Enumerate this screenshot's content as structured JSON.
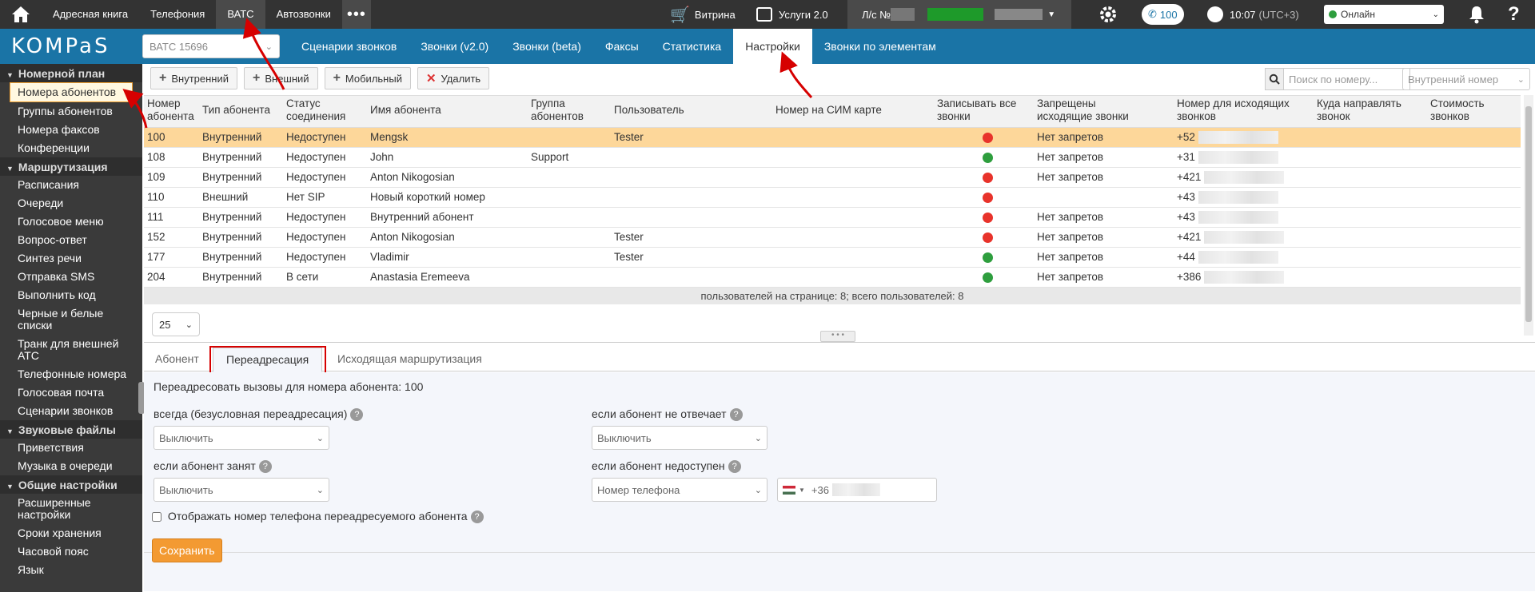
{
  "topbar": {
    "links": [
      "Адресная книга",
      "Телефония",
      "ВАТС",
      "Автозвонки"
    ],
    "active": "ВАТС",
    "vitrina": "Витрина",
    "services": "Услуги 2.0",
    "account_label": "Л/с №",
    "call_count": "100",
    "time": "10:07",
    "timezone": "(UTC+3)",
    "status": "Онлайн"
  },
  "navbar": {
    "logo": "KOMPaS",
    "vats_select": "ВАТС 15696",
    "tabs": [
      "Сценарии звонков",
      "Звонки (v2.0)",
      "Звонки (beta)",
      "Факсы",
      "Статистика",
      "Настройки",
      "Звонки по элементам"
    ],
    "active_tab": "Настройки"
  },
  "sidebar": {
    "sections": [
      {
        "title": "Номерной план",
        "items": [
          "Номера абонентов",
          "Группы абонентов",
          "Номера факсов",
          "Конференции"
        ]
      },
      {
        "title": "Маршрутизация",
        "items": [
          "Расписания",
          "Очереди",
          "Голосовое меню",
          "Вопрос-ответ",
          "Синтез речи",
          "Отправка SMS",
          "Выполнить код",
          "Черные и белые списки",
          "Транк для внешней АТС",
          "Телефонные номера",
          "Голосовая почта",
          "Сценарии звонков"
        ]
      },
      {
        "title": "Звуковые файлы",
        "items": [
          "Приветствия",
          "Музыка в очереди"
        ]
      },
      {
        "title": "Общие настройки",
        "items": [
          "Расширенные настройки",
          "Сроки хранения",
          "Часовой пояс",
          "Язык"
        ]
      }
    ],
    "active_item": "Номера абонентов"
  },
  "toolbar": {
    "internal": "Внутренний",
    "external": "Внешний",
    "mobile": "Мобильный",
    "delete": "Удалить",
    "search_placeholder": "Поиск по номеру...",
    "filter_select": "Внутренний номер"
  },
  "table": {
    "headers": [
      "Номер абонента",
      "Тип абонента",
      "Статус соединения",
      "Имя абонента",
      "Группа абонентов",
      "Пользователь",
      "Номер на СИМ карте",
      "Записывать все звонки",
      "Запрещены исходящие звонки",
      "Номер для исходящих звонков",
      "Куда направлять звонок",
      "Стоимость звонков"
    ],
    "rows": [
      {
        "num": "100",
        "type": "Внутренний",
        "status": "Недоступен",
        "name": "Mengsk",
        "group": "",
        "user": "Tester",
        "record": "red",
        "restrict": "Нет запретов",
        "out": "+52",
        "selected": true
      },
      {
        "num": "108",
        "type": "Внутренний",
        "status": "Недоступен",
        "name": "John",
        "group": "Support",
        "user": "",
        "record": "green",
        "restrict": "Нет запретов",
        "out": "+31",
        "selected": false
      },
      {
        "num": "109",
        "type": "Внутренний",
        "status": "Недоступен",
        "name": "Anton Nikogosian",
        "group": "",
        "user": "",
        "record": "red",
        "restrict": "Нет запретов",
        "out": "+421",
        "selected": false
      },
      {
        "num": "110",
        "type": "Внешний",
        "status": "Нет SIP",
        "name": "Новый короткий номер",
        "group": "",
        "user": "",
        "record": "red",
        "restrict": "",
        "out": "+43",
        "selected": false
      },
      {
        "num": "111",
        "type": "Внутренний",
        "status": "Недоступен",
        "name": "Внутренний абонент",
        "group": "",
        "user": "",
        "record": "red",
        "restrict": "Нет запретов",
        "out": "+43",
        "selected": false
      },
      {
        "num": "152",
        "type": "Внутренний",
        "status": "Недоступен",
        "name": "Anton Nikogosian",
        "group": "",
        "user": "Tester",
        "record": "red",
        "restrict": "Нет запретов",
        "out": "+421",
        "selected": false
      },
      {
        "num": "177",
        "type": "Внутренний",
        "status": "Недоступен",
        "name": "Vladimir",
        "group": "",
        "user": "Tester",
        "record": "green",
        "restrict": "Нет запретов",
        "out": "+44",
        "selected": false
      },
      {
        "num": "204",
        "type": "Внутренний",
        "status": "В сети",
        "name": "Anastasia Eremeeva",
        "group": "",
        "user": "",
        "record": "green",
        "restrict": "Нет запретов",
        "out": "+386",
        "selected": false
      }
    ],
    "footer": "пользователей на странице: 8; всего пользователей: 8",
    "page_size": "25"
  },
  "details": {
    "tabs": [
      "Абонент",
      "Переадресация",
      "Исходящая маршрутизация"
    ],
    "active_tab": "Переадресация",
    "heading": "Переадресовать вызовы для номера абонента: 100",
    "always_label": "всегда (безусловная переадресация)",
    "always_value": "Выключить",
    "busy_label": "если абонент занят",
    "busy_value": "Выключить",
    "noanswer_label": "если абонент не отвечает",
    "noanswer_value": "Выключить",
    "unavailable_label": "если абонент недоступен",
    "unavailable_value": "Номер телефона",
    "phone_prefix": "+36",
    "show_number_label": "Отображать номер телефона переадресуемого абонента",
    "save": "Сохранить"
  },
  "colors": {
    "accent": "#1a74a6",
    "topbar": "#333333",
    "selected_row": "#fdd79a",
    "save": "#f39a32",
    "green": "#2e9e3e",
    "red": "#e8332b",
    "annotation": "#d60000"
  }
}
